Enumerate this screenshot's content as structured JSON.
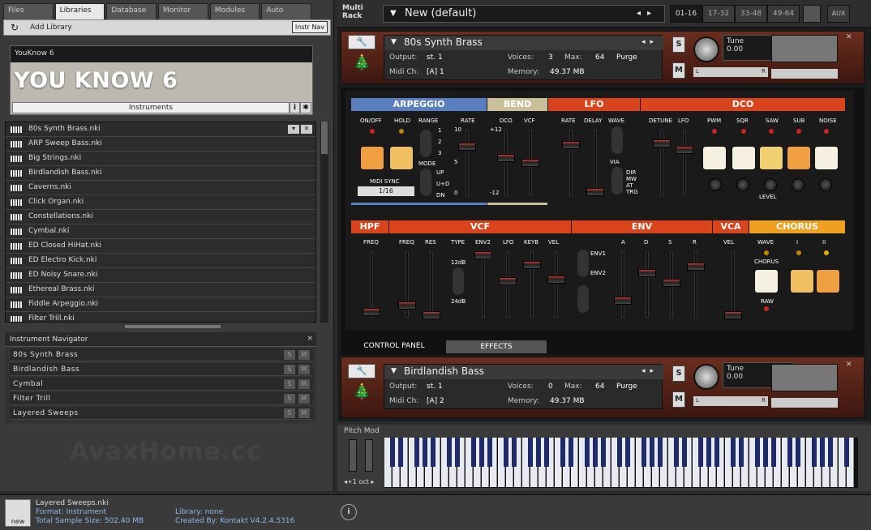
{
  "browser": {
    "tabs": [
      "Files",
      "Libraries",
      "Database",
      "Monitor",
      "Modules",
      "Auto"
    ],
    "active_tab": "Libraries",
    "add_library": "Add Library",
    "instr_nav_button": "Instr Nav",
    "library": {
      "header": "YouKnow 6",
      "name": "YOU KNOW 6",
      "footer": "Instruments",
      "info": "i",
      "gear": "✱"
    },
    "files": [
      "80s Synth Brass.nki",
      "ARP Sweep Bass.nki",
      "Big Strings.nki",
      "Birdlandish Bass.nki",
      "Caverns.nki",
      "Click Organ.nki",
      "Constellations.nki",
      "Cymbal.nki",
      "ED Closed HiHat.nki",
      "ED Electro Kick.nki",
      "ED Noisy Snare.nki",
      "Ethereal Brass.nki",
      "Fiddle Arpeggio.nki",
      "Filter Trill.nki"
    ]
  },
  "navigator": {
    "title": "Instrument Navigator",
    "items": [
      "80s Synth Brass",
      "Birdlandish Bass",
      "Cymbal",
      "Filter Trill",
      "Layered Sweeps"
    ],
    "s": "S",
    "m": "M",
    "close": "×"
  },
  "watermark": "AvaxHome.cc",
  "status": {
    "new_label": "new",
    "file": "Layered Sweeps.nki",
    "format": "Format: Instrument",
    "size": "Total Sample Size: 502.40 MB",
    "library": "Library: none",
    "created": "Created By: Kontakt V4.2.4.5316",
    "info": "i"
  },
  "rack": {
    "label_line1": "Multi",
    "label_line2": "Rack",
    "preset": "New (default)",
    "pages": [
      "01-16",
      "17-32",
      "33-48",
      "49-64"
    ],
    "active_page": "01-16",
    "aux": "AUX"
  },
  "instrument1": {
    "name": "80s Synth Brass",
    "output_label": "Output:",
    "output": "st. 1",
    "voices_label": "Voices:",
    "voices": "3",
    "max_label": "Max:",
    "max": "64",
    "purge": "Purge",
    "midi_label": "Midi Ch:",
    "midi": "[A]  1",
    "memory_label": "Memory:",
    "memory": "49.37 MB",
    "tune_label": "Tune",
    "tune": "0.00",
    "s": "S",
    "m": "M",
    "l": "L",
    "r": "R"
  },
  "instrument2": {
    "name": "Birdlandish Bass",
    "output_label": "Output:",
    "output": "st. 1",
    "voices_label": "Voices:",
    "voices": "0",
    "max_label": "Max:",
    "max": "64",
    "purge": "Purge",
    "midi_label": "Midi Ch:",
    "midi": "[A]  2",
    "memory_label": "Memory:",
    "memory": "49.37 MB",
    "tune_label": "Tune",
    "tune": "0.00",
    "s": "S",
    "m": "M",
    "l": "L",
    "r": "R"
  },
  "synth": {
    "sections_top": [
      "ARPEGGIO",
      "BEND",
      "LFO",
      "DCO"
    ],
    "sections_bottom": [
      "HPF",
      "VCF",
      "ENV",
      "VCA",
      "CHORUS"
    ],
    "arp": {
      "onoff": "ON/OFF",
      "hold": "HOLD",
      "range": "RANGE",
      "rate": "RATE",
      "midisync": "MIDI SYNC",
      "sync_value": "1/16",
      "mode": "MODE",
      "modes": [
        "UP",
        "U+D",
        "DN"
      ],
      "ranges": [
        "1",
        "2",
        "3"
      ]
    },
    "bend": {
      "dco": "DCO",
      "vcf": "VCF"
    },
    "lfo": {
      "rate": "RATE",
      "delay": "DELAY",
      "wave": "WAVE",
      "via": "VIA",
      "via_opts": [
        "DIR",
        "MW",
        "AT",
        "TRG"
      ]
    },
    "dco": {
      "detune": "DETUNE",
      "lfo": "LFO",
      "pwm": "PWM",
      "sqr": "SQR",
      "saw": "SAW",
      "sub": "SUB",
      "noise": "NOISE",
      "level": "LEVEL"
    },
    "hpf": {
      "freq": "FREQ"
    },
    "vcf": {
      "freq": "FREQ",
      "res": "RES",
      "type": "TYPE",
      "env2": "ENV2",
      "lfo": "LFO",
      "keyb": "KEYB",
      "vel": "VEL",
      "types": [
        "12dB",
        "24dB"
      ]
    },
    "env": {
      "env1": "ENV1",
      "env2": "ENV2",
      "a": "A",
      "d": "D",
      "s": "S",
      "r": "R"
    },
    "vca": {
      "vel": "VEL"
    },
    "chorus": {
      "wave": "WAVE",
      "chorus": "CHORUS",
      "raw": "RAW",
      "i": "I",
      "ii": "II"
    },
    "scale": {
      "top": "10",
      "mid": "5",
      "bot": "0",
      "plus12": "+12",
      "minus12": "-12",
      "plus10": "+10",
      "minus10": "-10"
    },
    "tabs": [
      "CONTROL PANEL",
      "EFFECTS"
    ],
    "active_tab": "CONTROL PANEL",
    "colors": {
      "arpeggio": "#5a7fbf",
      "bend": "#c9c09a",
      "red": "#d9441c",
      "orange": "#f0a020"
    }
  },
  "keyboard": {
    "pitch_mod": "Pitch Mod",
    "octave": "◂+1 oct ▸"
  }
}
